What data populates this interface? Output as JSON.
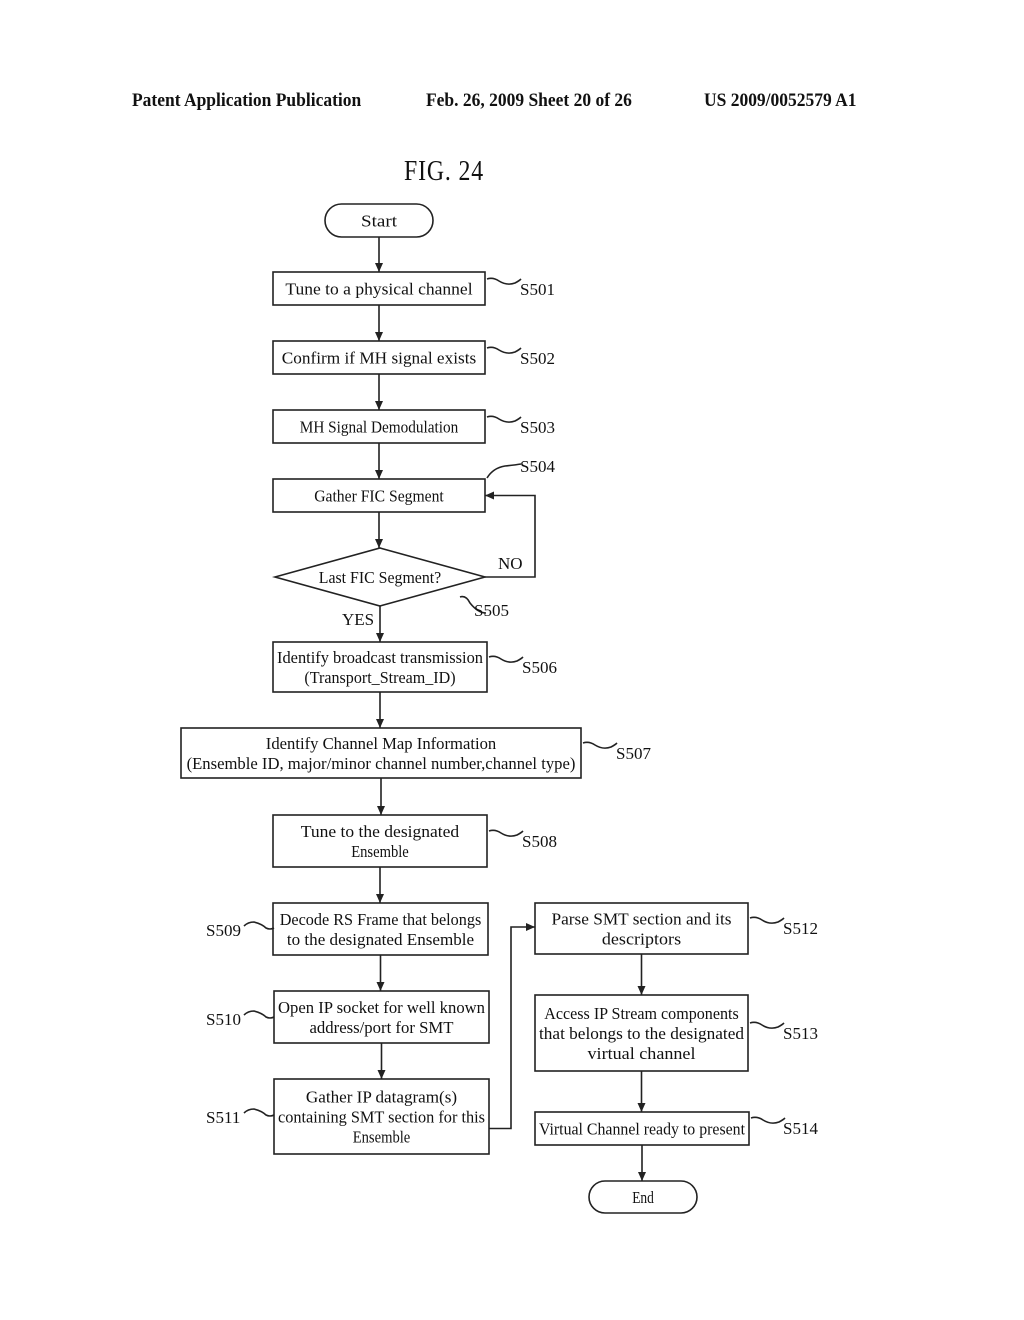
{
  "header": {
    "left": "Patent Application Publication",
    "middle": "Feb. 26, 2009   Sheet 20 of 26",
    "right": "US 2009/0052579 A1"
  },
  "figure": {
    "title": "FIG. 24"
  },
  "flowchart": {
    "nodes": [
      {
        "id": "start",
        "type": "terminal",
        "lines": [
          "Start"
        ],
        "label": ""
      },
      {
        "id": "s501",
        "type": "process",
        "lines": [
          "Tune to a physical channel"
        ],
        "label": "S501"
      },
      {
        "id": "s502",
        "type": "process",
        "lines": [
          "Confirm if MH signal exists"
        ],
        "label": "S502"
      },
      {
        "id": "s503",
        "type": "process",
        "lines": [
          "MH Signal Demodulation"
        ],
        "label": "S503"
      },
      {
        "id": "s504",
        "type": "process",
        "lines": [
          "Gather FIC Segment"
        ],
        "label": "S504"
      },
      {
        "id": "s505",
        "type": "decision",
        "lines": [
          "Last FIC Segment?"
        ],
        "label": "S505"
      },
      {
        "id": "s506",
        "type": "process",
        "lines": [
          "Identify broadcast transmission",
          "(Transport_Stream_ID)"
        ],
        "label": "S506"
      },
      {
        "id": "s507",
        "type": "process",
        "lines": [
          "Identify Channel Map Information",
          "(Ensemble ID, major/minor channel number,channel type)"
        ],
        "label": "S507"
      },
      {
        "id": "s508",
        "type": "process",
        "lines": [
          "Tune to the designated",
          "Ensemble"
        ],
        "label": "S508"
      },
      {
        "id": "s509",
        "type": "process",
        "lines": [
          "Decode RS Frame that belongs",
          "to the designated Ensemble"
        ],
        "label": "S509"
      },
      {
        "id": "s510",
        "type": "process",
        "lines": [
          "Open IP socket for well known",
          "address/port for SMT"
        ],
        "label": "S510"
      },
      {
        "id": "s511",
        "type": "process",
        "lines": [
          "Gather IP datagram(s)",
          "containing SMT section for this",
          "Ensemble"
        ],
        "label": "S511"
      },
      {
        "id": "s512",
        "type": "process",
        "lines": [
          "Parse SMT section and its",
          "descriptors"
        ],
        "label": "S512"
      },
      {
        "id": "s513",
        "type": "process",
        "lines": [
          "Access IP Stream components",
          "that belongs to the designated",
          "virtual channel"
        ],
        "label": "S513"
      },
      {
        "id": "s514",
        "type": "process",
        "lines": [
          "Virtual Channel ready to present"
        ],
        "label": "S514"
      },
      {
        "id": "end",
        "type": "terminal",
        "lines": [
          "End"
        ],
        "label": ""
      }
    ],
    "edges": [
      {
        "from": "start",
        "to": "s501",
        "label": ""
      },
      {
        "from": "s501",
        "to": "s502",
        "label": ""
      },
      {
        "from": "s502",
        "to": "s503",
        "label": ""
      },
      {
        "from": "s503",
        "to": "s504",
        "label": ""
      },
      {
        "from": "s504",
        "to": "s505",
        "label": ""
      },
      {
        "from": "s505",
        "to": "s504",
        "label": "NO"
      },
      {
        "from": "s505",
        "to": "s506",
        "label": "YES"
      },
      {
        "from": "s506",
        "to": "s507",
        "label": ""
      },
      {
        "from": "s507",
        "to": "s508",
        "label": ""
      },
      {
        "from": "s508",
        "to": "s509",
        "label": ""
      },
      {
        "from": "s509",
        "to": "s510",
        "label": ""
      },
      {
        "from": "s510",
        "to": "s511",
        "label": ""
      },
      {
        "from": "s511",
        "to": "s512",
        "label": ""
      },
      {
        "from": "s512",
        "to": "s513",
        "label": ""
      },
      {
        "from": "s513",
        "to": "s514",
        "label": ""
      },
      {
        "from": "s514",
        "to": "end",
        "label": ""
      }
    ]
  }
}
